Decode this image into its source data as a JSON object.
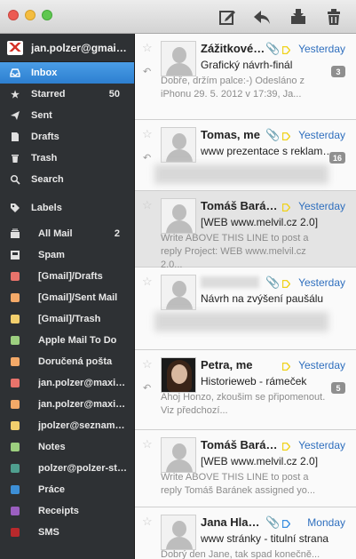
{
  "toolbar": {
    "buttons": [
      {
        "name": "compose-icon"
      },
      {
        "name": "reply-icon"
      },
      {
        "name": "archive-icon"
      },
      {
        "name": "trash-icon"
      }
    ]
  },
  "account": {
    "name": "jan.polzer@gmail.com"
  },
  "mailboxes": [
    {
      "label": "Inbox",
      "icon": "inbox-icon",
      "count": "",
      "active": true
    },
    {
      "label": "Starred",
      "icon": "star-icon",
      "count": "50"
    },
    {
      "label": "Sent",
      "icon": "sent-icon",
      "count": ""
    },
    {
      "label": "Drafts",
      "icon": "drafts-icon",
      "count": ""
    },
    {
      "label": "Trash",
      "icon": "trash-icon",
      "count": ""
    },
    {
      "label": "Search",
      "icon": "search-icon",
      "count": ""
    }
  ],
  "labels_header": "Labels",
  "labels": [
    {
      "label": "All Mail",
      "count": "2",
      "icon": "all-mail-icon"
    },
    {
      "label": "Spam",
      "count": "",
      "icon": "spam-icon"
    },
    {
      "label": "[Gmail]/Drafts",
      "color": "#e8736b"
    },
    {
      "label": "[Gmail]/Sent Mail",
      "color": "#f3a968"
    },
    {
      "label": "[Gmail]/Trash",
      "color": "#f2cf6d"
    },
    {
      "label": "Apple Mail To Do",
      "color": "#9ccf7f"
    },
    {
      "label": "Doručená pošta",
      "color": "#f3a968"
    },
    {
      "label": "jan.polzer@maxiorel.cz",
      "color": "#e8736b"
    },
    {
      "label": "jan.polzer@maxiorel.cz/Sent",
      "color": "#f3a968"
    },
    {
      "label": "jpolzer@seznam.cz",
      "color": "#f2cf6d"
    },
    {
      "label": "Notes",
      "color": "#9ccf7f"
    },
    {
      "label": "polzer@polzer-studio.cz",
      "color": "#4f9f8f"
    },
    {
      "label": "Práce",
      "color": "#3d8fd6"
    },
    {
      "label": "Receipts",
      "color": "#9b5fc0"
    },
    {
      "label": "SMS",
      "color": "#b8292c"
    }
  ],
  "messages": [
    {
      "sender": "Zážitkové dárky",
      "date": "Yesterday",
      "subject": "Grafický návrh-finál",
      "preview": "Dobře, držím palce:-) Odesláno z iPhonu 29. 5. 2012 v 17:39, Ja...",
      "count": "3",
      "attach": true,
      "tag": true,
      "replied": true
    },
    {
      "sender": "Tomas, me",
      "date": "Yesterday",
      "subject": "www prezentace s reklamou",
      "preview": "",
      "count": "16",
      "attach": true,
      "tag": true,
      "replied": true
    },
    {
      "sender": "Tomáš Baránek",
      "date": "Yesterday",
      "subject": "[WEB www.melvil.cz 2.0]",
      "preview": "Write ABOVE THIS LINE to post a reply Project: WEB www.melvil.cz 2.0...",
      "count": "",
      "attach": false,
      "tag": true,
      "selected": true
    },
    {
      "sender": "",
      "date": "Yesterday",
      "subject": "Návrh na zvýšení paušálu",
      "preview": "",
      "count": "",
      "attach": true,
      "tag": true
    },
    {
      "sender": "Petra, me",
      "date": "Yesterday",
      "subject": "Historieweb - rámeček",
      "preview": "Ahoj Honzo, zkoušim se připomenout. Viz předchozí...",
      "count": "5",
      "attach": false,
      "tag": true,
      "replied": true,
      "photo": true
    },
    {
      "sender": "Tomáš Baránek",
      "date": "Yesterday",
      "subject": "[WEB www.melvil.cz 2.0]",
      "preview": "Write ABOVE THIS LINE to post a reply Tomáš Baránek assigned yo...",
      "count": "",
      "attach": false,
      "tag": true
    },
    {
      "sender": "Jana Hladíková",
      "date": "Monday",
      "subject": "www stránky - titulní strana",
      "preview": "Dobrý den Jane, tak spad konečně...",
      "count": "",
      "attach": true,
      "tag": true,
      "tagBlue": true
    }
  ]
}
